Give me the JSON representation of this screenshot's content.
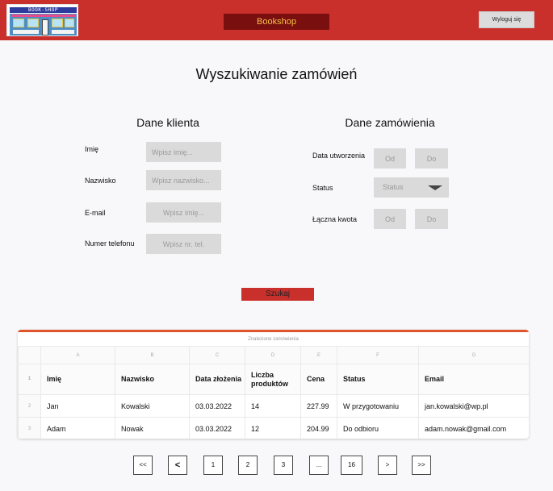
{
  "header": {
    "logo_text": "BOOK-SHOP",
    "brand": "Bookshop",
    "logout_label": "Wyloguj się",
    "color": "#c9302c"
  },
  "page_title": "Wyszukiwanie zamówień",
  "client_section": {
    "title": "Dane klienta",
    "fields": [
      {
        "label": "Imię",
        "placeholder": "Wpisz imię..."
      },
      {
        "label": "Nazwisko",
        "placeholder": "Wpisz nazwisko..."
      },
      {
        "label": "E-mail",
        "placeholder": "Wpisz imię..."
      },
      {
        "label": "Numer telefonu",
        "placeholder": "Wpisz nr. tel."
      }
    ]
  },
  "order_section": {
    "title": "Dane zamówienia",
    "created_label": "Data utworzenia",
    "created_from": "Od",
    "created_to": "Do",
    "status_label": "Status",
    "status_value": "Status",
    "total_label": "Łączna kwota",
    "total_from": "Od",
    "total_to": "Do"
  },
  "search_label": "Szukaj",
  "results": {
    "caption": "Znalezione zamówienia",
    "column_letters": [
      "A",
      "B",
      "C",
      "D",
      "E",
      "F",
      "G"
    ],
    "row_numbers": [
      "1",
      "2",
      "3"
    ],
    "headers": [
      "Imię",
      "Nazwisko",
      "Data złożenia",
      "Liczba produktów",
      "Cena",
      "Status",
      "Email"
    ],
    "rows": [
      [
        "Jan",
        "Kowalski",
        "03.03.2022",
        "14",
        "227.99",
        "W przygotowaniu",
        "jan.kowalski@wp.pl"
      ],
      [
        "Adam",
        "Nowak",
        "03.03.2022",
        "12",
        "204.99",
        "Do odbioru",
        "adam.nowak@gmail.com"
      ]
    ]
  },
  "pagination": [
    "<<",
    "<",
    "1",
    "2",
    "3",
    "...",
    "16",
    ">",
    ">>"
  ]
}
